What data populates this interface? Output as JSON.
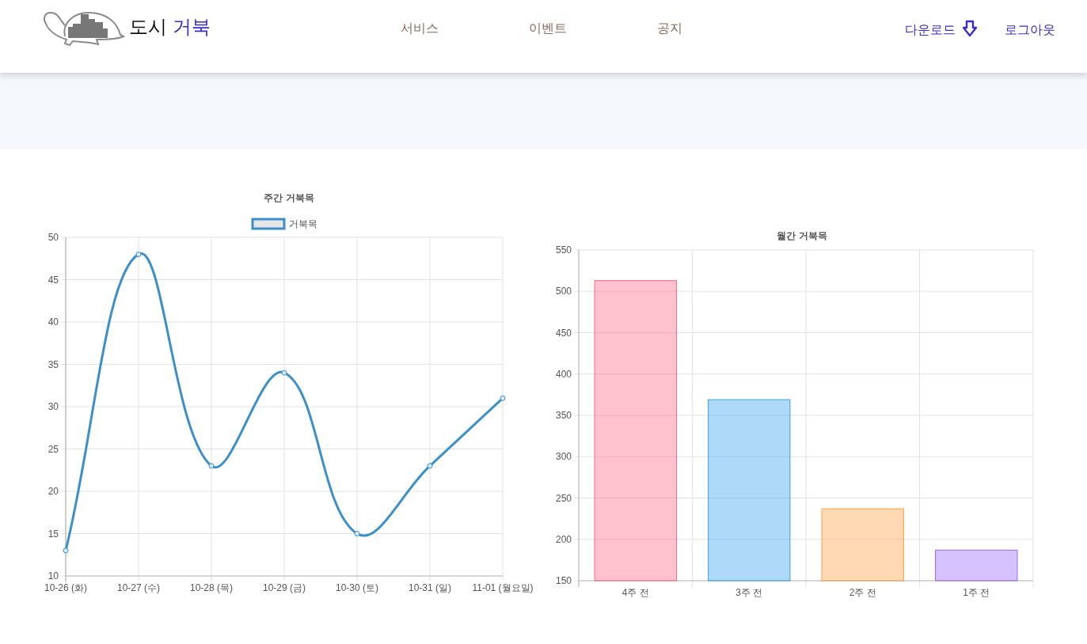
{
  "header": {
    "brand": {
      "first": "도시",
      "second": "거북"
    },
    "nav": [
      {
        "label": "서비스"
      },
      {
        "label": "이벤트"
      },
      {
        "label": "공지"
      }
    ],
    "actions": {
      "download": "다운로드",
      "logout": "로그아웃"
    }
  },
  "charts": [
    {
      "chart_data": {
        "type": "line",
        "title": "주간 거북목",
        "categories": [
          "10-26 (화)",
          "10-27 (수)",
          "10-28 (목)",
          "10-29 (금)",
          "10-30 (토)",
          "10-31 (일)",
          "11-01 (월요일)"
        ],
        "series": [
          {
            "name": "거북목",
            "color": "#3b8fcb",
            "marker": true,
            "values": [
              13,
              48,
              23,
              34,
              15,
              23,
              31
            ]
          }
        ],
        "ylim": [
          10,
          50
        ],
        "yticks": [
          10,
          15,
          20,
          25,
          30,
          35,
          40,
          45,
          50
        ],
        "grid": true
      }
    },
    {
      "chart_data": {
        "type": "bar",
        "title": "월간 거북목",
        "grid": true,
        "categories": [
          "4주 전",
          "3주 전",
          "2주 전",
          "1주 전"
        ],
        "series": [
          {
            "colors": [
              "#ff6384",
              "#36a2eb",
              "#ff9f40",
              "#9966ff"
            ],
            "values": [
              513,
              369,
              237,
              187
            ]
          }
        ],
        "ylim": [
          150,
          550
        ],
        "yticks": [
          150,
          200,
          250,
          300,
          350,
          400,
          450,
          500,
          550
        ]
      }
    }
  ]
}
